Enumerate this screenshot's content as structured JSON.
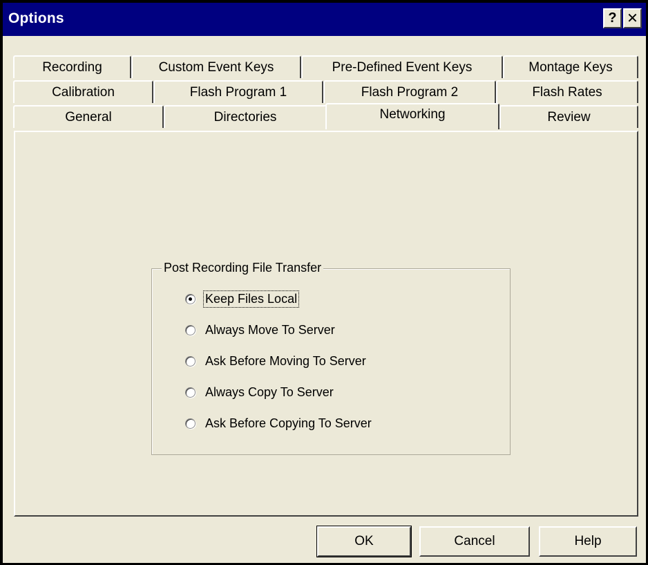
{
  "window": {
    "title": "Options",
    "help_glyph": "?",
    "close_glyph": "✕"
  },
  "tabs": {
    "row1": [
      "Recording",
      "Custom Event Keys",
      "Pre-Defined Event Keys",
      "Montage Keys"
    ],
    "row2": [
      "Calibration",
      "Flash Program 1",
      "Flash Program 2",
      "Flash Rates"
    ],
    "row3": [
      "General",
      "Directories",
      "Networking",
      "Review"
    ],
    "active": "Networking"
  },
  "networking": {
    "group_label": "Post Recording File Transfer",
    "options": [
      {
        "label": "Keep Files Local",
        "checked": true
      },
      {
        "label": "Always Move To Server",
        "checked": false
      },
      {
        "label": "Ask Before Moving To Server",
        "checked": false
      },
      {
        "label": "Always Copy To Server",
        "checked": false
      },
      {
        "label": "Ask Before Copying To Server",
        "checked": false
      }
    ]
  },
  "buttons": {
    "ok": "OK",
    "cancel": "Cancel",
    "help": "Help"
  }
}
